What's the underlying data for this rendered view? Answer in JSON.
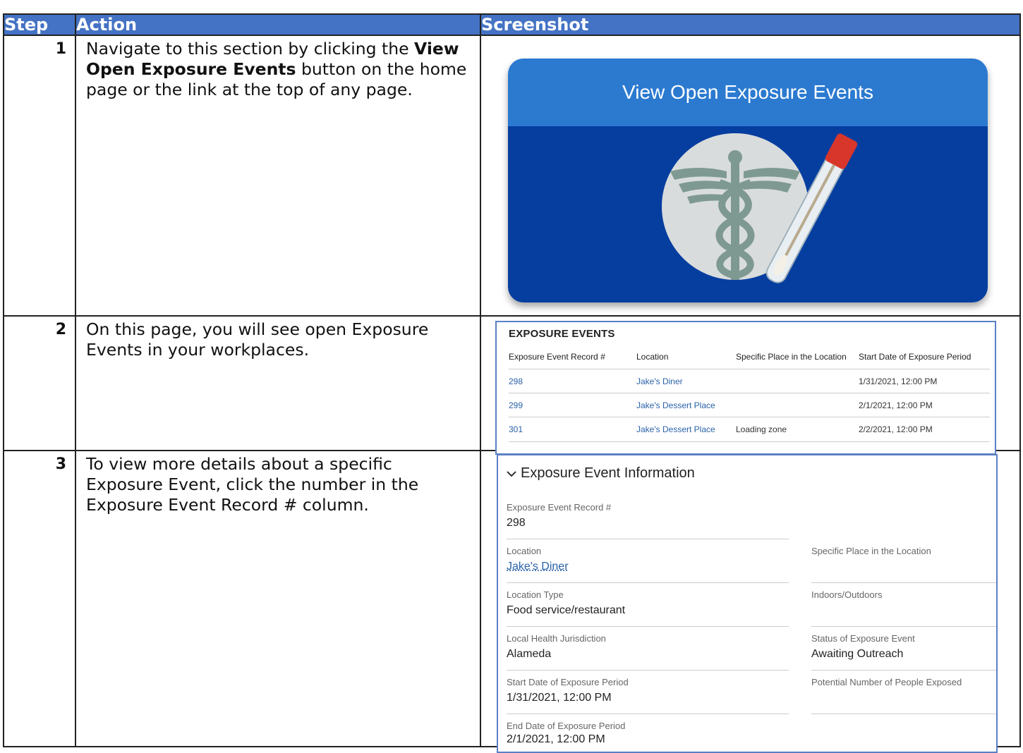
{
  "table": {
    "headers": {
      "step": "Step",
      "action": "Action",
      "screenshot": "Screenshot"
    }
  },
  "rows": [
    {
      "step": "1",
      "action_pre": "Navigate to this section by clicking the ",
      "action_bold": "View Open Exposure Events",
      "action_post": " button on the home page or the link at the top of any page."
    },
    {
      "step": "2",
      "action_pre": "On this page, you will see open Exposure Events in your workplaces."
    },
    {
      "step": "3",
      "action_pre": "To view more details about a specific Exposure Event, click the number in the Exposure Event Record # column."
    }
  ],
  "card": {
    "title": "View Open Exposure Events",
    "colors": {
      "top": "#2b7ad0",
      "bottom": "#063ea0"
    },
    "icon": "caduceus-test-tube-icon"
  },
  "events": {
    "title": "EXPOSURE EVENTS",
    "columns": [
      "Exposure Event Record #",
      "Location",
      "Specific Place in the Location",
      "Start Date of Exposure Period"
    ],
    "rows": [
      {
        "record": "298",
        "location": "Jake's Diner",
        "place": "",
        "start": "1/31/2021, 12:00 PM"
      },
      {
        "record": "299",
        "location": "Jake's Dessert Place",
        "place": "",
        "start": "2/1/2021, 12:00 PM"
      },
      {
        "record": "301",
        "location": "Jake's Dessert Place",
        "place": "Loading zone",
        "start": "2/2/2021, 12:00 PM"
      }
    ]
  },
  "detail": {
    "title": "Exposure Event Information",
    "fields": {
      "record_label": "Exposure Event Record #",
      "record_value": "298",
      "location_label": "Location",
      "location_value": "Jake's Diner",
      "place_label": "Specific Place in the Location",
      "type_label": "Location Type",
      "type_value": "Food service/restaurant",
      "inout_label": "Indoors/Outdoors",
      "lhj_label": "Local Health Jurisdiction",
      "lhj_value": "Alameda",
      "status_label": "Status of Exposure Event",
      "status_value": "Awaiting Outreach",
      "start_label": "Start Date of Exposure Period",
      "start_value": "1/31/2021, 12:00 PM",
      "people_label": "Potential Number of People Exposed",
      "end_label": "End Date of Exposure Period",
      "end_value": "2/1/2021, 12:00 PM"
    }
  }
}
